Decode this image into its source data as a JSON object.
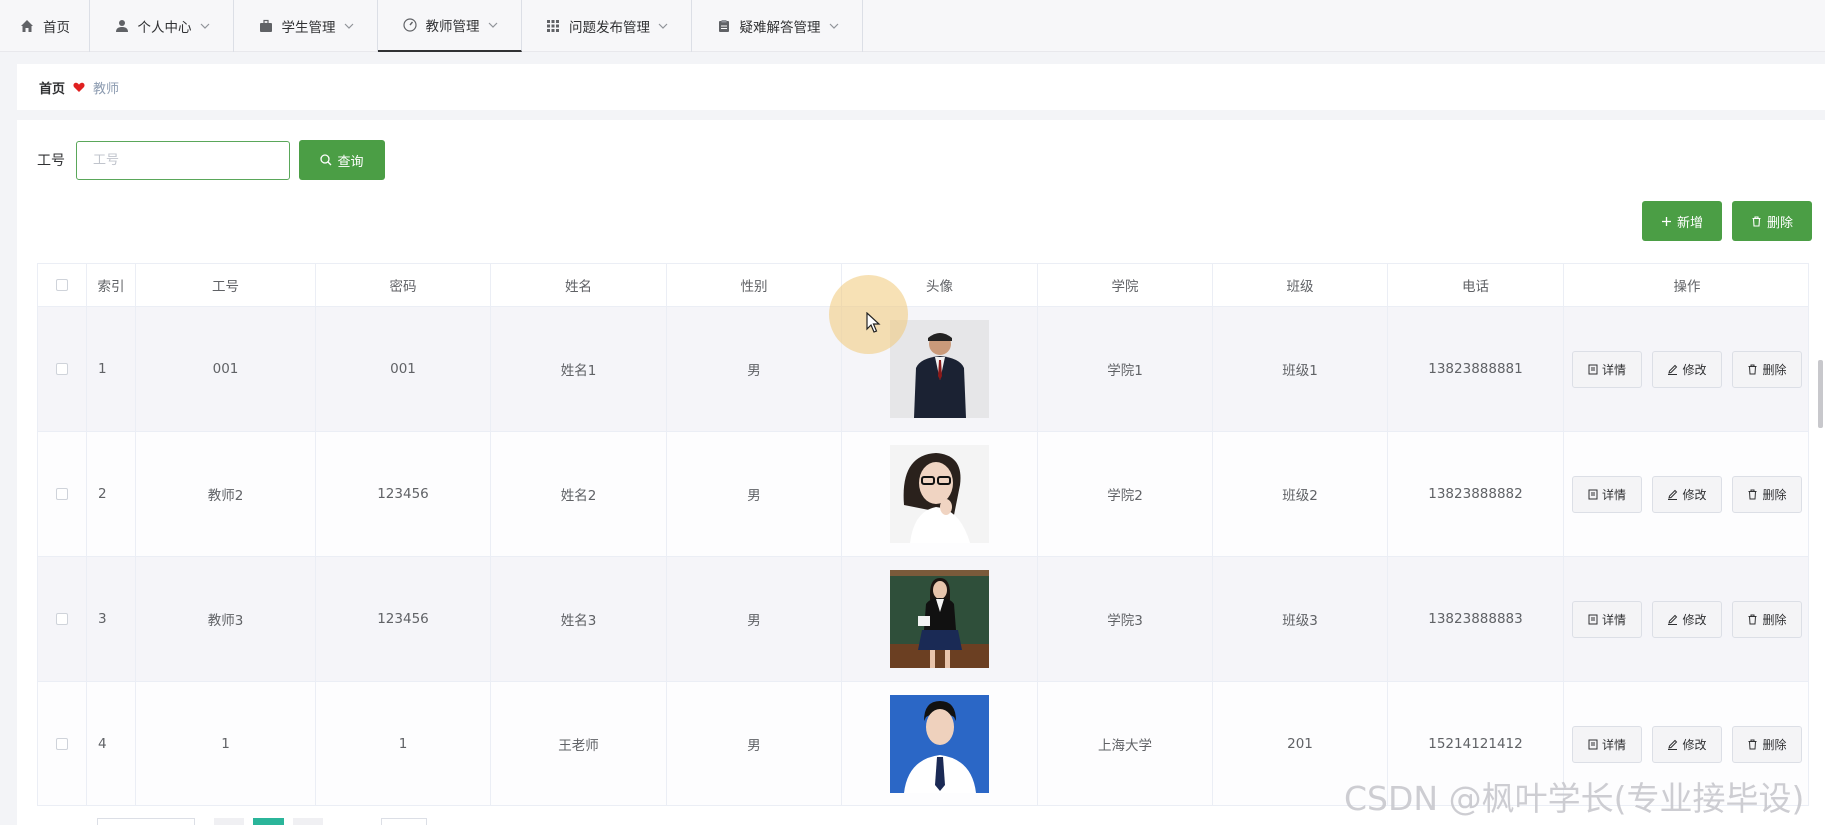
{
  "nav": {
    "items": [
      {
        "label": "首页",
        "icon": "home-icon",
        "has_dropdown": false,
        "active": false
      },
      {
        "label": "个人中心",
        "icon": "user-icon",
        "has_dropdown": true,
        "active": false
      },
      {
        "label": "学生管理",
        "icon": "briefcase-icon",
        "has_dropdown": true,
        "active": false
      },
      {
        "label": "教师管理",
        "icon": "gauge-icon",
        "has_dropdown": true,
        "active": true
      },
      {
        "label": "问题发布管理",
        "icon": "grid-icon",
        "has_dropdown": true,
        "active": false
      },
      {
        "label": "疑难解答管理",
        "icon": "clipboard-icon",
        "has_dropdown": true,
        "active": false
      }
    ]
  },
  "breadcrumb": {
    "home": "首页",
    "current": "教师",
    "separator_icon": "heart-icon",
    "separator_color": "#e02020"
  },
  "search": {
    "label": "工号",
    "placeholder": "工号",
    "value": "",
    "button_label": "查询"
  },
  "toolbar": {
    "add_label": "新增",
    "delete_label": "删除"
  },
  "table": {
    "columns": [
      "",
      "索引",
      "工号",
      "密码",
      "姓名",
      "性别",
      "头像",
      "学院",
      "班级",
      "电话",
      "操作"
    ],
    "rows": [
      {
        "index": "1",
        "job_no": "001",
        "password": "001",
        "name": "姓名1",
        "gender": "男",
        "college": "学院1",
        "class": "班级1",
        "phone": "13823888881"
      },
      {
        "index": "2",
        "job_no": "教师2",
        "password": "123456",
        "name": "姓名2",
        "gender": "男",
        "college": "学院2",
        "class": "班级2",
        "phone": "13823888882"
      },
      {
        "index": "3",
        "job_no": "教师3",
        "password": "123456",
        "name": "姓名3",
        "gender": "男",
        "college": "学院3",
        "class": "班级3",
        "phone": "13823888883"
      },
      {
        "index": "4",
        "job_no": "1",
        "password": "1",
        "name": "王老师",
        "gender": "男",
        "college": "上海大学",
        "class": "201",
        "phone": "15214121412"
      }
    ],
    "actions": {
      "detail": "详情",
      "edit": "修改",
      "delete": "删除"
    }
  },
  "watermark": "CSDN @枫叶学长(专业接毕设)",
  "colors": {
    "primary_green": "#4b9e45",
    "accent_active_border": "#303133"
  }
}
